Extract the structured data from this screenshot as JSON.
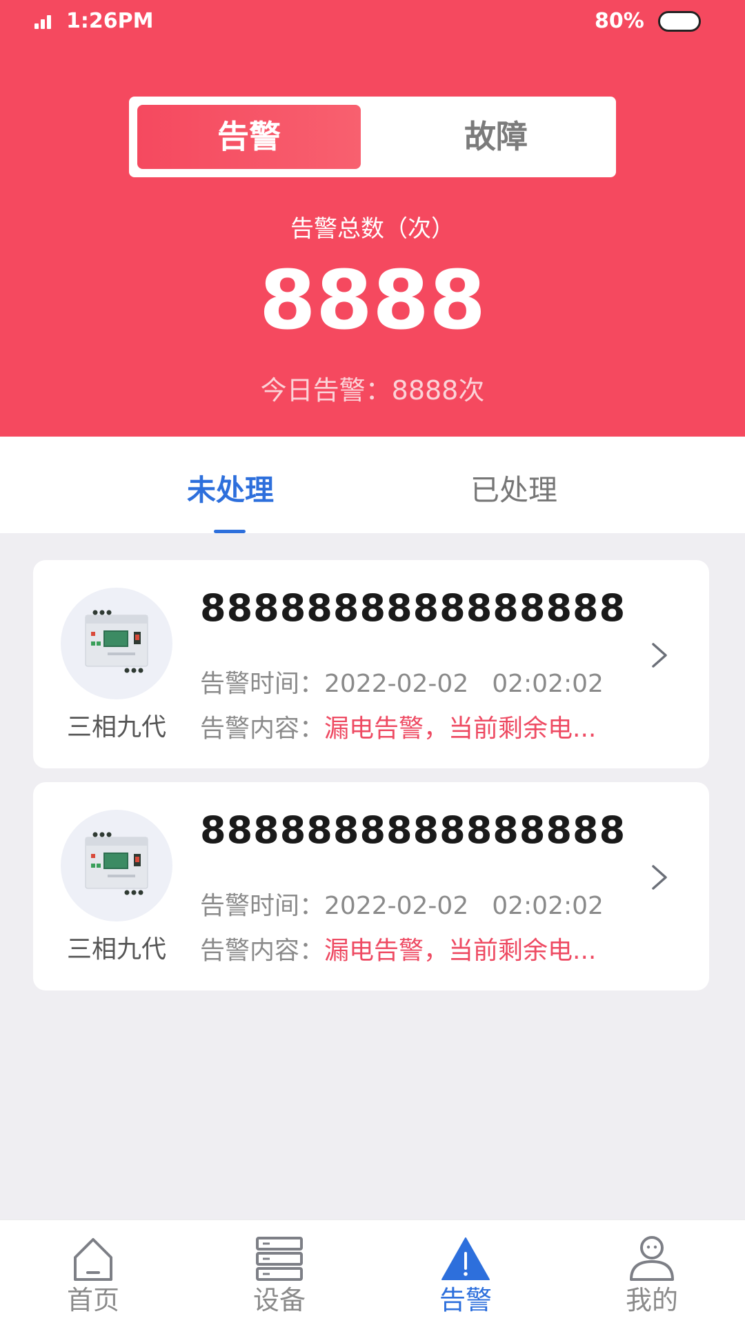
{
  "status_bar": {
    "time": "1:26PM",
    "battery": "80%"
  },
  "header": {
    "segments": [
      {
        "label": "告警",
        "active": true
      },
      {
        "label": "故障",
        "active": false
      }
    ],
    "total_label": "告警总数（次）",
    "total_value": "8888",
    "today_stat": "今日告警：8888次"
  },
  "tabs": [
    {
      "label": "未处理",
      "active": true
    },
    {
      "label": "已处理",
      "active": false
    }
  ],
  "alarms": [
    {
      "device_name": "三相九代",
      "title": "8888888888888888",
      "time_label": "告警时间：",
      "date": "2022-02-02",
      "time": "02:02:02",
      "content_label": "告警内容：",
      "content": "漏电告警，当前剩余电..."
    },
    {
      "device_name": "三相九代",
      "title": "8888888888888888",
      "time_label": "告警时间：",
      "date": "2022-02-02",
      "time": "02:02:02",
      "content_label": "告警内容：",
      "content": "漏电告警，当前剩余电..."
    }
  ],
  "bottom_nav": [
    {
      "label": "首页",
      "icon": "home-icon",
      "active": false
    },
    {
      "label": "设备",
      "icon": "device-icon",
      "active": false
    },
    {
      "label": "告警",
      "icon": "alarm-icon",
      "active": true
    },
    {
      "label": "我的",
      "icon": "profile-icon",
      "active": false
    }
  ],
  "colors": {
    "header_red": "#f5495f",
    "accent_blue": "#2d6fdc",
    "alert_text": "#ee4a62"
  }
}
